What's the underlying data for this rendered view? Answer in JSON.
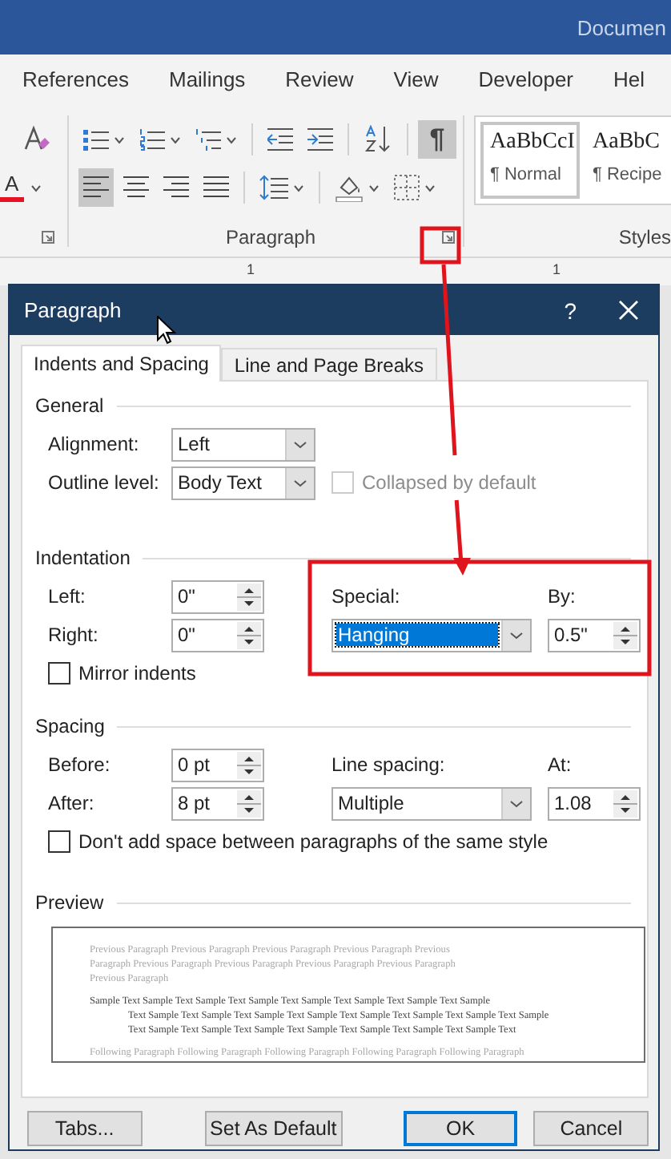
{
  "app": {
    "title": "Documen"
  },
  "ribbon_tabs": [
    {
      "label": "References"
    },
    {
      "label": "Mailings"
    },
    {
      "label": "Review"
    },
    {
      "label": "View"
    },
    {
      "label": "Developer"
    },
    {
      "label": "Hel"
    }
  ],
  "ribbon": {
    "font_color": {
      "label": "A"
    },
    "paragraph": {
      "label": "Paragraph",
      "row1": [
        {
          "kind": "bullets",
          "on": false
        },
        {
          "kind": "numbering",
          "on": false
        },
        {
          "kind": "multilevel",
          "on": false
        },
        {
          "kind": "decrease_indent",
          "on": false
        },
        {
          "kind": "increase_indent",
          "on": false
        },
        {
          "kind": "sort",
          "on": false
        },
        {
          "kind": "show_marks",
          "on": true,
          "label": "¶"
        }
      ],
      "row2": [
        {
          "kind": "align_left",
          "on": true
        },
        {
          "kind": "align_center",
          "on": false
        },
        {
          "kind": "align_right",
          "on": false
        },
        {
          "kind": "justify",
          "on": false
        },
        {
          "kind": "line_spacing",
          "on": false
        },
        {
          "kind": "shading",
          "on": false
        },
        {
          "kind": "borders",
          "on": false
        }
      ]
    },
    "styles": {
      "label": "Styles",
      "items": [
        {
          "sample": "AaBbCcI",
          "name": "¶ Normal",
          "selected": true
        },
        {
          "sample": "AaBbC",
          "name": "¶ Recipe",
          "selected": false
        }
      ]
    }
  },
  "ruler": {
    "labels": [
      "1",
      "1"
    ]
  },
  "dialog": {
    "title": "Paragraph",
    "help": "?",
    "tabs": [
      {
        "label": "Indents and Spacing",
        "selected": true
      },
      {
        "label": "Line and Page Breaks",
        "selected": false
      }
    ],
    "general": {
      "heading": "General",
      "alignment": {
        "label": "Alignment:",
        "value": "Left",
        "focused": false
      },
      "outline_level": {
        "label": "Outline level:",
        "value": "Body Text",
        "focused": false
      },
      "collapsed": {
        "label": "Collapsed by default",
        "checked": false,
        "disabled": true
      }
    },
    "indentation": {
      "heading": "Indentation",
      "left": {
        "label": "Left:",
        "value": "0\""
      },
      "right": {
        "label": "Right:",
        "value": "0\""
      },
      "special": {
        "label": "Special:",
        "value": "Hanging",
        "focused": true
      },
      "by": {
        "label": "By:",
        "value": "0.5\""
      },
      "mirror": {
        "label": "Mirror indents",
        "checked": false,
        "disabled": false
      }
    },
    "spacing": {
      "heading": "Spacing",
      "before": {
        "label": "Before:",
        "value": "0 pt"
      },
      "after": {
        "label": "After:",
        "value": "8 pt"
      },
      "line_spacing": {
        "label": "Line spacing:",
        "value": "Multiple",
        "focused": false
      },
      "at": {
        "label": "At:",
        "value": "1.08"
      },
      "dont_add_space": {
        "label": "Don't add space between paragraphs of the same style",
        "checked": false,
        "disabled": false
      }
    },
    "preview": {
      "heading": "Preview",
      "previous_lines": [
        "Previous Paragraph Previous Paragraph Previous Paragraph Previous Paragraph Previous",
        "Paragraph Previous Paragraph Previous Paragraph Previous Paragraph Previous Paragraph",
        "Previous Paragraph"
      ],
      "sample_lines": [
        "Sample Text Sample Text Sample Text Sample Text Sample Text Sample Text Sample Text Sample",
        "Text Sample Text Sample Text Sample Text Sample Text Sample Text Sample Text Sample Text Sample",
        "Text Sample Text Sample Text Sample Text Sample Text Sample Text Sample Text Sample Text"
      ],
      "following_lines": [
        "Following Paragraph Following Paragraph Following Paragraph Following Paragraph Following Paragraph"
      ]
    },
    "buttons": [
      {
        "label": "Tabs...",
        "default": false
      },
      {
        "label": "Set As Default",
        "default": false
      },
      {
        "label": "OK",
        "default": true
      },
      {
        "label": "Cancel",
        "default": false
      }
    ]
  }
}
